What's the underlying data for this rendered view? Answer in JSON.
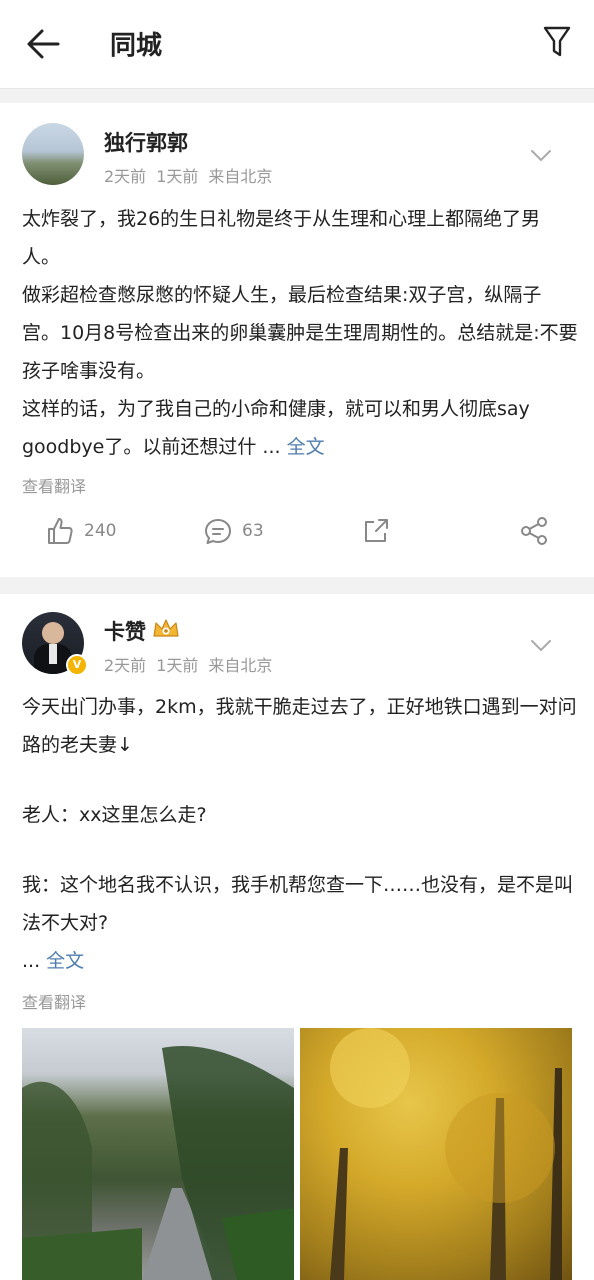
{
  "header": {
    "title": "同城",
    "back_icon": "arrow-left-icon",
    "filter_icon": "filter-icon"
  },
  "posts": [
    {
      "username": "独行郭郭",
      "meta": [
        "2天前",
        "1天前",
        "来自北京"
      ],
      "paragraphs": [
        "太炸裂了，我26的生日礼物是终于从生理和心理上都隔绝了男人。",
        "做彩超检查憋尿憋的怀疑人生，最后检查结果:双子宫，纵隔子宫。10月8号检查出来的卵巢囊肿是生理周期性的。总结就是:不要孩子啥事没有。",
        "这样的话，为了我自己的小命和健康，就可以和男人彻底say goodbye了。以前还想过什 ..."
      ],
      "more": "全文",
      "translate": "查看翻译",
      "likes": "240",
      "comments": "63"
    },
    {
      "username": "卡赞",
      "meta": [
        "2天前",
        "1天前",
        "来自北京"
      ],
      "paragraphs": [
        "今天出门办事，2km，我就干脆走过去了，正好地铁口遇到一对问路的老夫妻↓",
        "老人：xx这里怎么走?",
        "我：这个地名我不认识，我手机帮您查一下……也没有，是不是叫法不大对?",
        "..."
      ],
      "more": "全文",
      "translate": "查看翻译",
      "verified_badge": "V"
    }
  ],
  "colors": {
    "link": "#507daf",
    "meta": "#999999",
    "divider": "#f2f2f2"
  }
}
